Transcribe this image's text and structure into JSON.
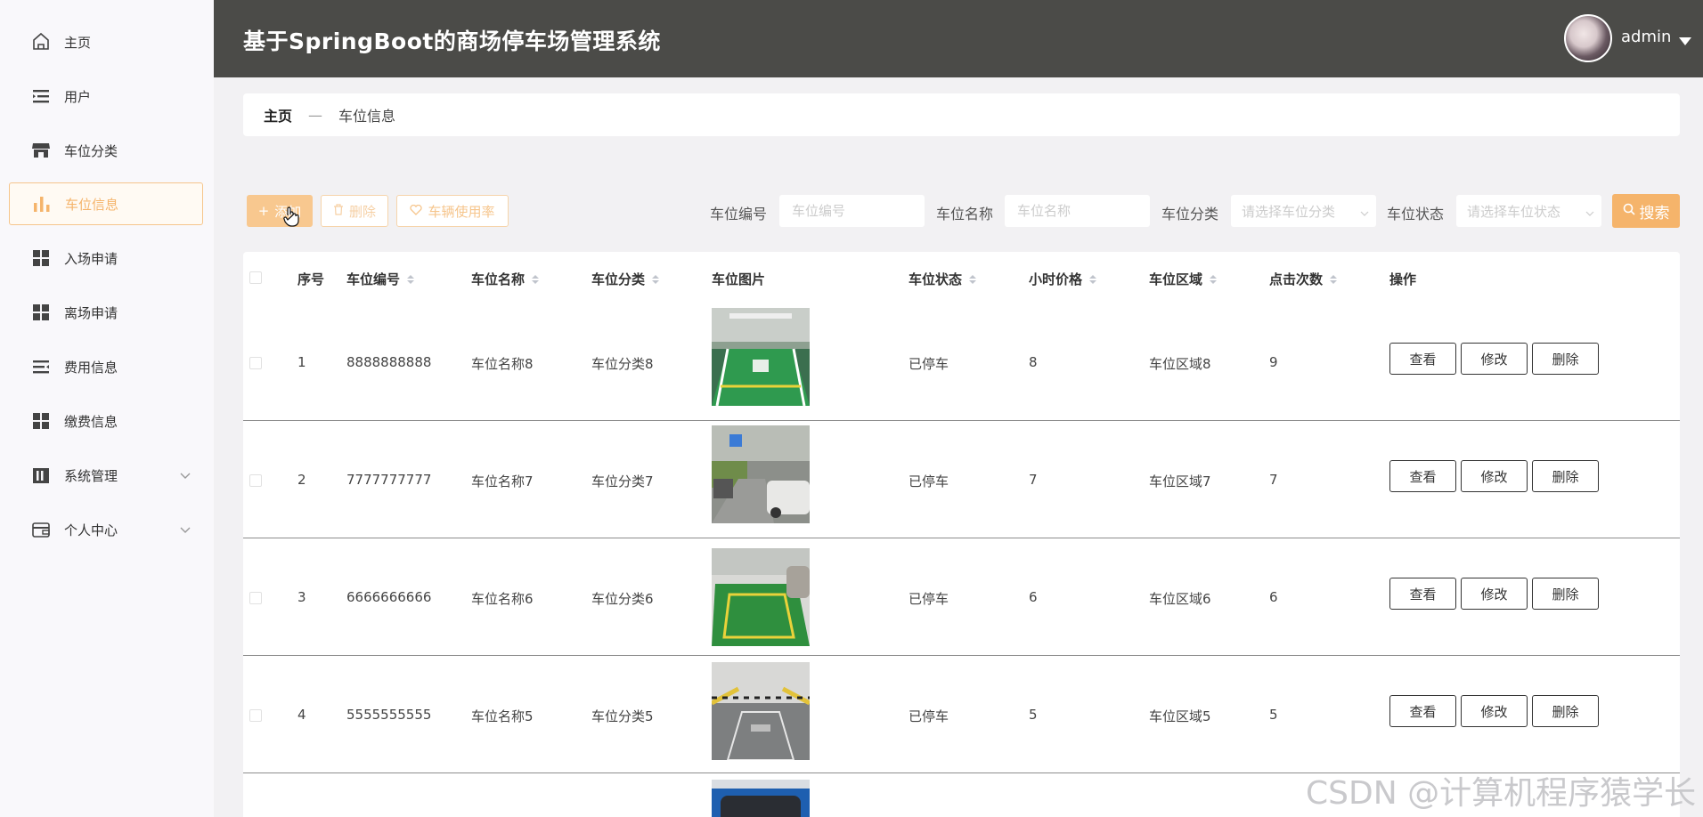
{
  "app": {
    "title": "基于SpringBoot的商场停车场管理系统"
  },
  "user": {
    "name": "admin"
  },
  "sidebar": {
    "items": [
      {
        "label": "主页",
        "icon": "home-icon"
      },
      {
        "label": "用户",
        "icon": "list-icon"
      },
      {
        "label": "车位分类",
        "icon": "store-icon"
      },
      {
        "label": "车位信息",
        "icon": "bar-chart-icon",
        "active": true
      },
      {
        "label": "入场申请",
        "icon": "grid-icon"
      },
      {
        "label": "离场申请",
        "icon": "grid-icon"
      },
      {
        "label": "费用信息",
        "icon": "list-indent-icon"
      },
      {
        "label": "缴费信息",
        "icon": "grid-icon"
      },
      {
        "label": "系统管理",
        "icon": "building-icon",
        "expandable": true
      },
      {
        "label": "个人中心",
        "icon": "wallet-icon",
        "expandable": true
      }
    ]
  },
  "breadcrumb": {
    "home": "主页",
    "separator": "—",
    "current": "车位信息"
  },
  "toolbar": {
    "add": "添加",
    "delete": "删除",
    "usage_rate": "车辆使用率",
    "search": "搜索"
  },
  "filters": {
    "code": {
      "label": "车位编号",
      "placeholder": "车位编号"
    },
    "name": {
      "label": "车位名称",
      "placeholder": "车位名称"
    },
    "category": {
      "label": "车位分类",
      "placeholder": "请选择车位分类"
    },
    "status": {
      "label": "车位状态",
      "placeholder": "请选择车位状态"
    }
  },
  "table": {
    "columns": [
      "序号",
      "车位编号",
      "车位名称",
      "车位分类",
      "车位图片",
      "车位状态",
      "小时价格",
      "车位区域",
      "点击次数",
      "操作"
    ],
    "actions": {
      "view": "查看",
      "edit": "修改",
      "delete": "删除"
    },
    "rows": [
      {
        "index": "1",
        "code": "8888888888",
        "name": "车位名称8",
        "category": "车位分类8",
        "status": "已停车",
        "price": "8",
        "area": "车位区域8",
        "clicks": "9"
      },
      {
        "index": "2",
        "code": "7777777777",
        "name": "车位名称7",
        "category": "车位分类7",
        "status": "已停车",
        "price": "7",
        "area": "车位区域7",
        "clicks": "7"
      },
      {
        "index": "3",
        "code": "6666666666",
        "name": "车位名称6",
        "category": "车位分类6",
        "status": "已停车",
        "price": "6",
        "area": "车位区域6",
        "clicks": "6"
      },
      {
        "index": "4",
        "code": "5555555555",
        "name": "车位名称5",
        "category": "车位分类5",
        "status": "已停车",
        "price": "5",
        "area": "车位区域5",
        "clicks": "5"
      }
    ]
  },
  "watermark": "CSDN @计算机程序猿学长",
  "colors": {
    "accent": "#f5b46b",
    "header_bg": "#4b4b48",
    "page_bg": "#f2f1f3"
  }
}
